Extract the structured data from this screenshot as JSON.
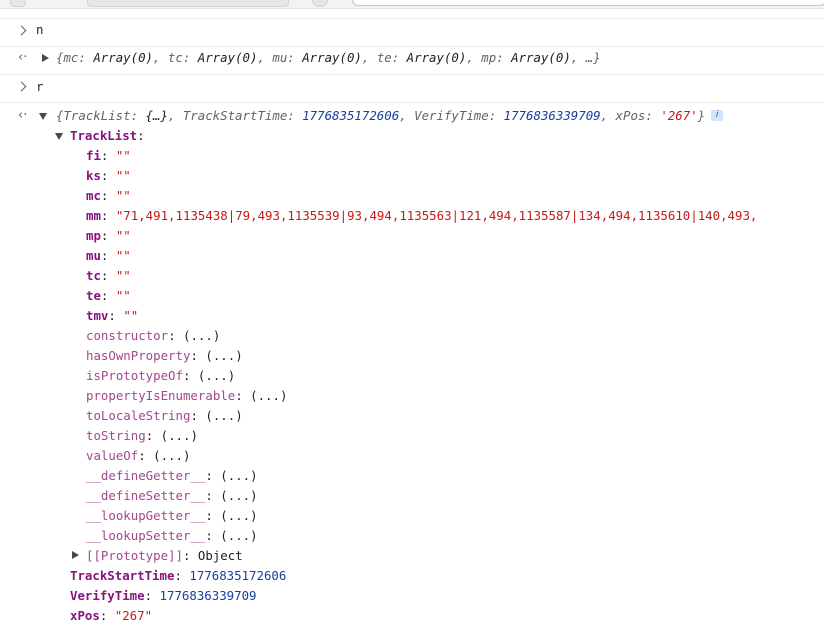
{
  "console": {
    "input1": "n",
    "output1": {
      "preview": [
        {
          "key": "mc",
          "value": "Array(0)"
        },
        {
          "key": "tc",
          "value": "Array(0)"
        },
        {
          "key": "mu",
          "value": "Array(0)"
        },
        {
          "key": "te",
          "value": "Array(0)"
        },
        {
          "key": "mp",
          "value": "Array(0)"
        }
      ],
      "ellipsis": "…"
    },
    "input2": "r",
    "output2": {
      "preview": {
        "tracklist_key": "TrackList",
        "tracklist_value": "{…}",
        "trackstart_key": "TrackStartTime",
        "trackstart_value": "1776835172606",
        "verify_key": "VerifyTime",
        "verify_value": "1776836339709",
        "xpos_key": "xPos",
        "xpos_value": "'267'",
        "info_badge": "i"
      },
      "tracklist_label": "TrackList",
      "props": [
        {
          "key": "fi",
          "value": "\"\""
        },
        {
          "key": "ks",
          "value": "\"\""
        },
        {
          "key": "mc",
          "value": "\"\""
        },
        {
          "key": "mm",
          "value": "\"71,491,1135438|79,493,1135539|93,494,1135563|121,494,1135587|134,494,1135610|140,493,"
        },
        {
          "key": "mp",
          "value": "\"\""
        },
        {
          "key": "mu",
          "value": "\"\""
        },
        {
          "key": "tc",
          "value": "\"\""
        },
        {
          "key": "te",
          "value": "\"\""
        },
        {
          "key": "tmv",
          "value": "\"\""
        }
      ],
      "methods": [
        "constructor",
        "hasOwnProperty",
        "isPrototypeOf",
        "propertyIsEnumerable",
        "toLocaleString",
        "toString",
        "valueOf",
        "__defineGetter__",
        "__defineSetter__",
        "__lookupGetter__",
        "__lookupSetter__"
      ],
      "method_value": "(...)",
      "prototype_key": "[[Prototype]]",
      "prototype_value": "Object",
      "trackstart_key": "TrackStartTime",
      "trackstart_value": "1776835172606",
      "verify_key": "VerifyTime",
      "verify_value": "1776836339709",
      "xpos_key": "xPos",
      "xpos_value": "\"267\""
    }
  }
}
